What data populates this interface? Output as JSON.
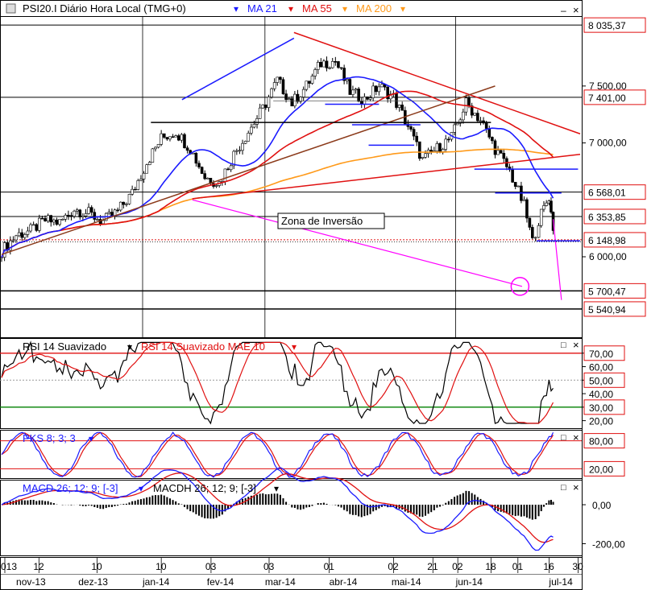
{
  "header": {
    "instrument": "PSI20.I Diário Hora Local (TMG+0)",
    "ma21_label": "MA 21",
    "ma55_label": "MA 55",
    "ma200_label": "MA 200"
  },
  "colors": {
    "price": "#000000",
    "ma21": "#1a1aff",
    "ma55": "#e01010",
    "ma200": "#ff9a1a",
    "magenta": "#ff00ff",
    "brown": "#8b3a1a",
    "level_box_border": "#e01010",
    "green": "#008000"
  },
  "annotation": {
    "zone_label": "Zona de  Inversão"
  },
  "rsi_panel": {
    "title": "RSI 14 Suavizado",
    "title2": "RSI 14 Suavizado MAE 10"
  },
  "pks_panel": {
    "title": "PKS 8; 3; 3"
  },
  "macd_panel": {
    "title": "MACD 26; 12; 9; [-3]",
    "title2": "MACDH 26; 12; 9; [-3]"
  },
  "window_icons": {
    "close": "×",
    "restore": "□",
    "minimize": "–"
  },
  "x_axis": {
    "day_labels": [
      "013",
      "12",
      "10",
      "10",
      "03",
      "03",
      "01",
      "02",
      "21",
      "02",
      "18",
      "01",
      "16",
      "30"
    ],
    "month_labels": [
      "nov-13",
      "dez-13",
      "jan-14",
      "fev-14",
      "mar-14",
      "abr-14",
      "mai-14",
      "jun-14",
      "jul-14"
    ]
  },
  "chart_data": [
    {
      "type": "line",
      "panel": "price",
      "y_ticks": [
        "7 500,00",
        "7 000,00",
        "6 000,00"
      ],
      "y_tick_values": [
        7500,
        7000,
        6000
      ],
      "level_labels": [
        "8 035,37",
        "7 401,00",
        "6 568,01",
        "6 353,85",
        "6 148,98",
        "5 700,47",
        "5 540,94"
      ],
      "level_values": [
        8035.37,
        7401.0,
        6568.01,
        6353.85,
        6148.98,
        5700.47,
        5540.94
      ],
      "ylim": [
        5300,
        8100
      ],
      "x_range": [
        "2013-10-25",
        "2014-07-31"
      ],
      "close_series": [
        [
          "2013-10-25",
          6050
        ],
        [
          "2013-11-01",
          6190
        ],
        [
          "2013-11-08",
          6230
        ],
        [
          "2013-11-15",
          6320
        ],
        [
          "2013-11-22",
          6300
        ],
        [
          "2013-11-29",
          6420
        ],
        [
          "2013-12-06",
          6380
        ],
        [
          "2013-12-13",
          6310
        ],
        [
          "2013-12-20",
          6400
        ],
        [
          "2013-12-27",
          6560
        ],
        [
          "2014-01-03",
          6830
        ],
        [
          "2014-01-10",
          7040
        ],
        [
          "2014-01-17",
          7100
        ],
        [
          "2014-01-24",
          6950
        ],
        [
          "2014-01-31",
          6700
        ],
        [
          "2014-02-07",
          6650
        ],
        [
          "2014-02-14",
          6900
        ],
        [
          "2014-02-21",
          7100
        ],
        [
          "2014-02-28",
          7300
        ],
        [
          "2014-03-07",
          7550
        ],
        [
          "2014-03-14",
          7350
        ],
        [
          "2014-03-21",
          7500
        ],
        [
          "2014-03-28",
          7700
        ],
        [
          "2014-04-04",
          7720
        ],
        [
          "2014-04-11",
          7450
        ],
        [
          "2014-04-18",
          7380
        ],
        [
          "2014-04-25",
          7500
        ],
        [
          "2014-05-02",
          7400
        ],
        [
          "2014-05-09",
          7150
        ],
        [
          "2014-05-16",
          6850
        ],
        [
          "2014-05-23",
          6950
        ],
        [
          "2014-05-30",
          7050
        ],
        [
          "2014-06-06",
          7350
        ],
        [
          "2014-06-13",
          7200
        ],
        [
          "2014-06-20",
          6950
        ],
        [
          "2014-06-27",
          6750
        ],
        [
          "2014-07-04",
          6450
        ],
        [
          "2014-07-08",
          6130
        ],
        [
          "2014-07-11",
          6320
        ],
        [
          "2014-07-16",
          6530
        ],
        [
          "2014-07-18",
          6230
        ]
      ]
    },
    {
      "type": "line",
      "panel": "rsi",
      "y_tick_labels": [
        "70,00",
        "60,00",
        "50,00",
        "40,00",
        "30,00",
        "20,00"
      ],
      "y_tick_values": [
        70,
        60,
        50,
        40,
        30,
        20
      ],
      "ylim": [
        15,
        80
      ]
    },
    {
      "type": "line",
      "panel": "pks",
      "y_tick_labels": [
        "80,00",
        "20,00"
      ],
      "y_tick_values": [
        80,
        20
      ],
      "ylim": [
        0,
        100
      ]
    },
    {
      "type": "line",
      "panel": "macd",
      "y_tick_labels": [
        "0,00",
        "-200,00"
      ],
      "y_tick_values": [
        0,
        -200
      ],
      "ylim": [
        -260,
        120
      ]
    }
  ]
}
